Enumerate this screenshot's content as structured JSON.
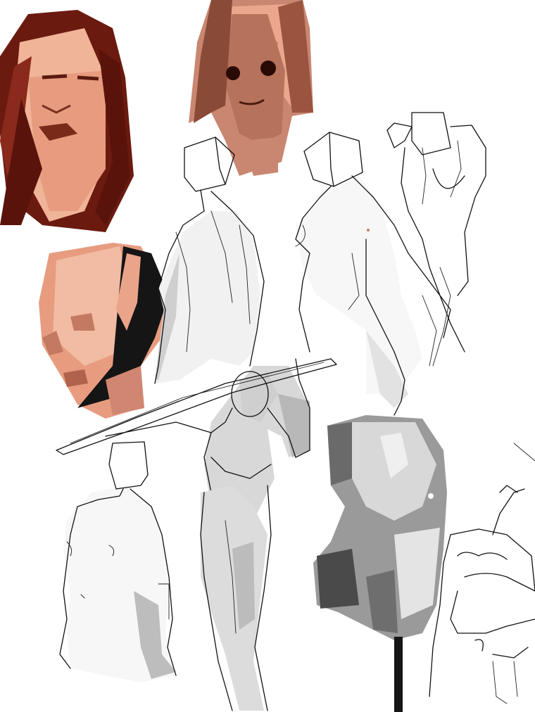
{
  "image": {
    "kind": "digital sketch page",
    "background_color": "#ffffff",
    "palette": {
      "hair_dark": "#6b1a10",
      "hair_mid": "#8a2a1c",
      "skin_light": "#f2b8a0",
      "skin_mid": "#e39a80",
      "skin_shadow": "#c47a62",
      "black": "#151515",
      "gray_light": "#d8d8d8",
      "gray_mid": "#9a9a9a",
      "gray_dark": "#4a4a4a",
      "line": "#111111"
    }
  },
  "figures": [
    {
      "name": "red-haired-woman-head",
      "style": "painted"
    },
    {
      "name": "long-hair-face",
      "style": "painted"
    },
    {
      "name": "bald-profile-head",
      "style": "painted"
    },
    {
      "name": "box-head-back-figure",
      "style": "line"
    },
    {
      "name": "box-head-torso-figure",
      "style": "line"
    },
    {
      "name": "arm-raised-torso",
      "style": "line"
    },
    {
      "name": "staff-carrying-figure",
      "style": "shaded line"
    },
    {
      "name": "standing-box-head-figure",
      "style": "shaded line"
    },
    {
      "name": "gray-torso-on-stand",
      "style": "painted grayscale"
    },
    {
      "name": "crouching-figure-sketch",
      "style": "line"
    }
  ]
}
